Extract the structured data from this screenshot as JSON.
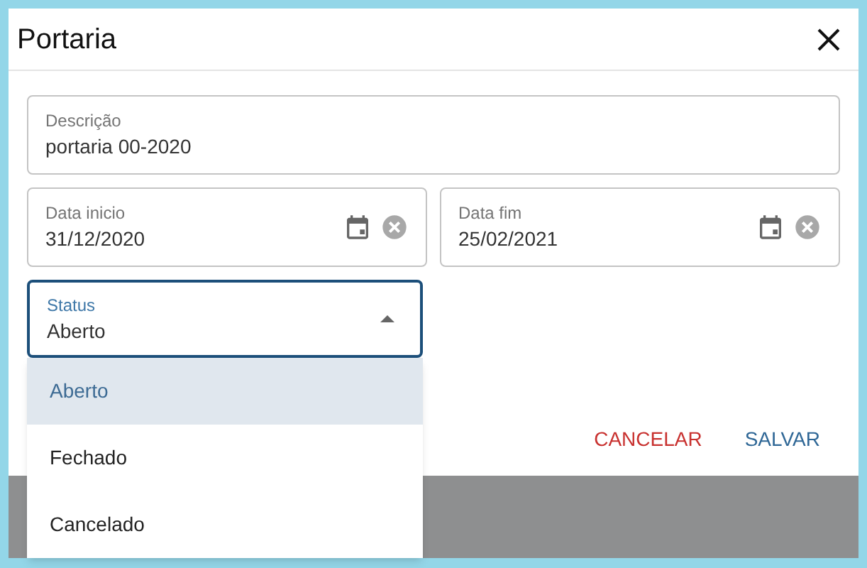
{
  "dialog": {
    "title": "Portaria"
  },
  "fields": [
    {
      "label": "Descrição",
      "value": "portaria 00-2020"
    }
  ],
  "dates": [
    {
      "label": "Data inicio",
      "value": "31/12/2020"
    },
    {
      "label": "Data fim",
      "value": "25/02/2021"
    }
  ],
  "status": {
    "label": "Status",
    "value": "Aberto",
    "expanded": true
  },
  "options": [
    {
      "label": "Aberto",
      "selected": true
    },
    {
      "label": "Fechado",
      "selected": false
    },
    {
      "label": "Cancelado",
      "selected": false
    }
  ],
  "buttons": [
    {
      "label": "CANCELAR",
      "kind": "cancel"
    },
    {
      "label": "SALVAR",
      "kind": "save"
    }
  ]
}
